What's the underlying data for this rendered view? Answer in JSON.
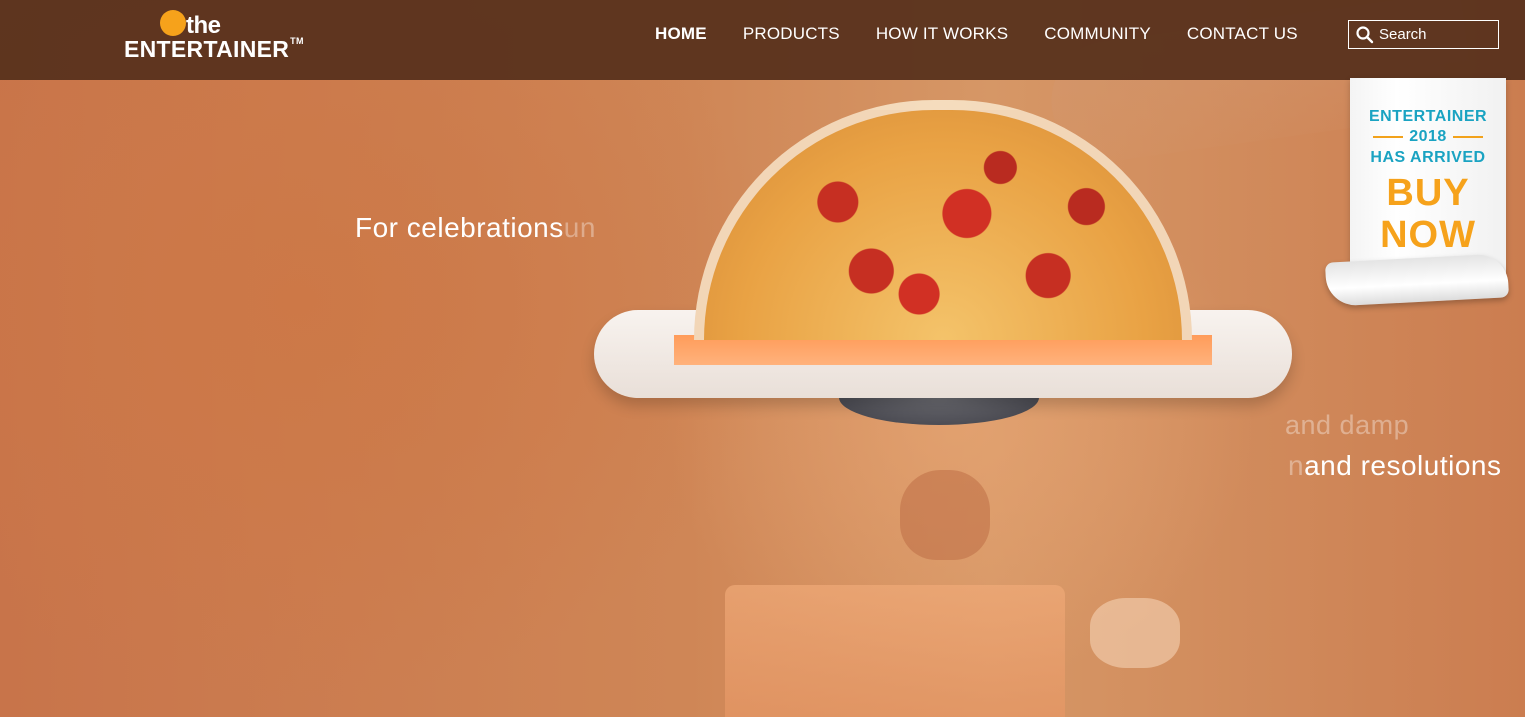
{
  "brand": {
    "logo_top": "the",
    "logo_main": "ENTERTAINER",
    "logo_tm": "TM"
  },
  "nav": {
    "items": [
      {
        "label": "HOME",
        "active": true
      },
      {
        "label": "PRODUCTS",
        "active": false
      },
      {
        "label": "HOW IT WORKS",
        "active": false
      },
      {
        "label": "COMMUNITY",
        "active": false
      },
      {
        "label": "CONTACT US",
        "active": false
      }
    ],
    "search_placeholder": "Search"
  },
  "hero": {
    "text_left": "For celebrations",
    "text_left_ghost": "un",
    "text_right_ghost": "and damp",
    "text_right_ghost2": "n",
    "text_right": "and resolutions"
  },
  "promo": {
    "line1": "ENTERTAINER",
    "year": "2018",
    "line2": "HAS ARRIVED",
    "cta_line1": "BUY",
    "cta_line2": "NOW"
  },
  "colors": {
    "nav_bg": "#58321c",
    "accent_orange": "#f6a21b",
    "accent_teal": "#1aa3c2"
  }
}
